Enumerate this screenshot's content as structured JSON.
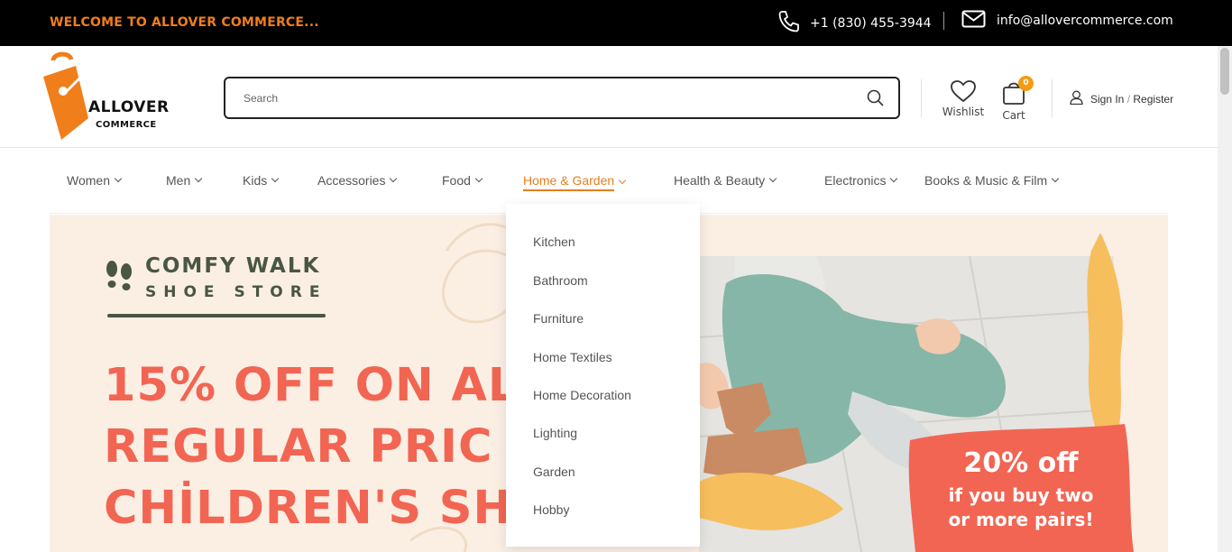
{
  "topbar": {
    "welcome": "WELCOME TO ALLOVER COMMERCE...",
    "phone": "+1 (830) 455-3944",
    "email": "info@allovercommerce.com"
  },
  "logo": {
    "line1": "ALLOVER",
    "line2": "COMMERCE"
  },
  "search": {
    "placeholder": "Search"
  },
  "header": {
    "wishlist": "Wishlist",
    "cart": "Cart",
    "cart_count": "0",
    "sign_in": "Sign In",
    "separator": "/",
    "register": "Register"
  },
  "nav": {
    "items": [
      {
        "label": "Women"
      },
      {
        "label": "Men"
      },
      {
        "label": "Kids"
      },
      {
        "label": "Accessories"
      },
      {
        "label": "Food"
      },
      {
        "label": "Home & Garden"
      },
      {
        "label": "Health & Beauty"
      },
      {
        "label": "Electronics"
      },
      {
        "label": "Books & Music & Film"
      }
    ],
    "active": "Home & Garden"
  },
  "dropdown": {
    "items": [
      "Kitchen",
      "Bathroom",
      "Furniture",
      "Home Textiles",
      "Home Decoration",
      "Lighting",
      "Garden",
      "Hobby"
    ]
  },
  "banner": {
    "store_name_1": "COMFY WALK",
    "store_name_2": "SHOE STORE",
    "headline_1": "15% OFF ON AL",
    "headline_2": "REGULAR PRIC",
    "headline_3": "CHİLDREN'S SH",
    "offer_1": "20% off",
    "offer_2": "if you buy two",
    "offer_3": "or more pairs!"
  },
  "colors": {
    "accent": "#e67e22",
    "topbar_bg": "#000000",
    "banner_bg": "#fbefe4",
    "headline": "#f26553",
    "offer_bg": "#f26553",
    "store_green": "#4a5644"
  }
}
